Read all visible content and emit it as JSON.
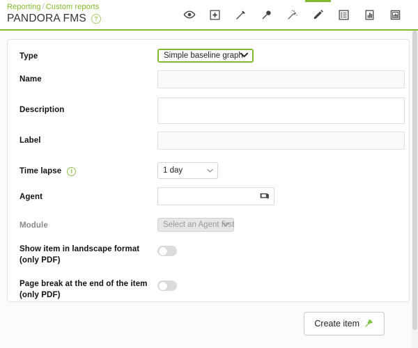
{
  "header": {
    "breadcrumb": {
      "parent": "Reporting",
      "separator": "/",
      "current": "Custom reports"
    },
    "title": "PANDORA FMS",
    "help_icon": "help-circle-icon",
    "accent_color": "#82b92e"
  },
  "toolbar": {
    "tabs": [
      {
        "name": "view-report",
        "icon": "eye-icon",
        "active": false
      },
      {
        "name": "add-item",
        "icon": "add-box-icon",
        "active": false
      },
      {
        "name": "wizard",
        "icon": "pin-icon",
        "active": false
      },
      {
        "name": "wizard-sla",
        "icon": "pin-round-icon",
        "active": false
      },
      {
        "name": "global-wizard",
        "icon": "magic-wand-icon",
        "active": false
      },
      {
        "name": "item-editor",
        "icon": "pencil-icon",
        "active": true
      },
      {
        "name": "list-items",
        "icon": "list-icon",
        "active": false
      },
      {
        "name": "graph-editor",
        "icon": "bar-chart-icon",
        "active": false
      },
      {
        "name": "advanced-options",
        "icon": "chart-box-icon",
        "active": false
      }
    ]
  },
  "form": {
    "type": {
      "label": "Type",
      "value": "Simple baseline graph",
      "focused": true
    },
    "name": {
      "label": "Name",
      "value": "",
      "placeholder": ""
    },
    "description": {
      "label": "Description",
      "value": "",
      "placeholder": ""
    },
    "label": {
      "label": "Label",
      "value": "",
      "placeholder": ""
    },
    "time_lapse": {
      "label": "Time lapse",
      "value": "1 day",
      "info_icon": "info-circle-icon"
    },
    "agent": {
      "label": "Agent",
      "value": "",
      "placeholder": "",
      "icon": "agent-server-icon"
    },
    "module": {
      "label": "Module",
      "value": "Select an Agent first",
      "disabled": true
    },
    "landscape": {
      "label": "Show item in landscape format (only PDF)",
      "state": "off"
    },
    "page_break": {
      "label": "Page break at the end of the item (only PDF)",
      "state": "off"
    }
  },
  "footer": {
    "create_button": {
      "label": "Create item",
      "icon": "pin-green-icon"
    }
  }
}
